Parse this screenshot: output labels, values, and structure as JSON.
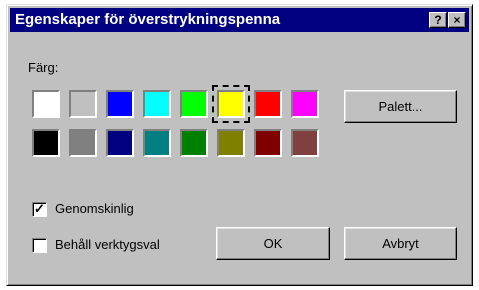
{
  "window": {
    "title": "Egenskaper för överstrykningspenna",
    "help_btn": "?",
    "close_btn": "×"
  },
  "color_section": {
    "label": "Färg:",
    "row1": [
      "#ffffff",
      "#c0c0c0",
      "#0000ff",
      "#00ffff",
      "#00ff00",
      "#ffff00",
      "#ff0000",
      "#ff00ff"
    ],
    "row2": [
      "#000000",
      "#808080",
      "#000080",
      "#008080",
      "#008000",
      "#808000",
      "#800000",
      "#804040"
    ],
    "selected_color": "#ffff00"
  },
  "buttons": {
    "palette": "Palett...",
    "ok": "OK",
    "cancel": "Avbryt"
  },
  "checkboxes": {
    "transparent": {
      "label": "Genomskinlig",
      "checked": true
    },
    "keep_tool": {
      "label": "Behåll verktygsval",
      "checked": false
    }
  }
}
